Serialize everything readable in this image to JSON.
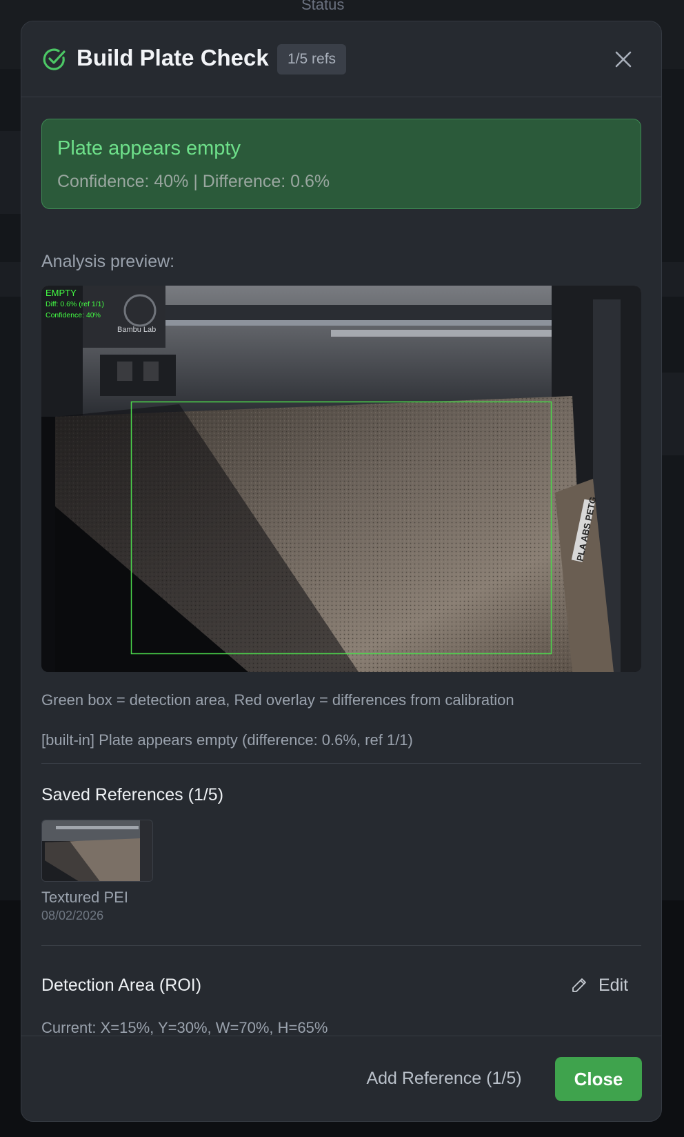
{
  "background": {
    "status_label": "Status"
  },
  "modal": {
    "title": "Build Plate Check",
    "refs_badge": "1/5 refs",
    "result": {
      "title": "Plate appears empty",
      "subtitle": "Confidence: 40% | Difference: 0.6%"
    },
    "preview_label": "Analysis preview:",
    "overlay": {
      "status": "EMPTY",
      "diff": "Diff: 0.6% (ref 1/1)",
      "confidence": "Confidence: 40%",
      "brand": "Bambu Lab",
      "plate_label": "PLA ABS PETG"
    },
    "caption": "Green box = detection area, Red overlay = differences from calibration",
    "builtin_note": "[built-in] Plate appears empty (difference: 0.6%, ref 1/1)",
    "saved_references": {
      "title": "Saved References (1/5)",
      "items": [
        {
          "name": "Textured PEI",
          "date": "08/02/2026"
        }
      ]
    },
    "roi": {
      "title": "Detection Area (ROI)",
      "edit_label": "Edit",
      "current": "Current: X=15%, Y=30%, W=70%, H=65%"
    },
    "footer": {
      "add_reference_label": "Add Reference (1/5)",
      "close_label": "Close"
    }
  },
  "colors": {
    "accent_green": "#3fa34d",
    "success_text": "#6ee08a",
    "detection_box": "#4cd94c"
  },
  "icons": [
    "check-circle-icon",
    "close-icon",
    "pencil-icon"
  ]
}
